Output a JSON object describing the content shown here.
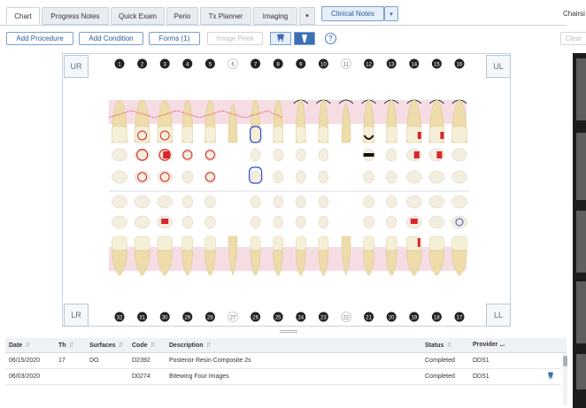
{
  "tabs": [
    {
      "label": "Chart",
      "active": true
    },
    {
      "label": "Progress Notes"
    },
    {
      "label": "Quick Exam"
    },
    {
      "label": "Perio"
    },
    {
      "label": "Tx Planner"
    },
    {
      "label": "Imaging"
    }
  ],
  "clinical_notes_label": "Clinical Notes",
  "chairside_label": "Chairsi",
  "toolbar": {
    "add_procedure": "Add Procedure",
    "add_condition": "Add Condition",
    "forms": "Forms (1)",
    "image_peek": "Image Peek",
    "help": "?",
    "clear": "Clear"
  },
  "quadrants": {
    "ur": "UR",
    "ul": "UL",
    "lr": "LR",
    "ll": "LL"
  },
  "upper_tooth_numbers": [
    "1",
    "2",
    "3",
    "4",
    "5",
    "6",
    "7",
    "8",
    "9",
    "10",
    "11",
    "12",
    "13",
    "14",
    "15",
    "16"
  ],
  "lower_tooth_numbers": [
    "32",
    "31",
    "30",
    "29",
    "28",
    "27",
    "26",
    "25",
    "24",
    "23",
    "22",
    "21",
    "20",
    "19",
    "18",
    "17"
  ],
  "colors": {
    "accent": "#2a5d9f",
    "restoration": "#d7262b",
    "watch": "#2b4fd6",
    "gum": "#f6dde3"
  },
  "grid": {
    "columns": [
      "Date",
      "Th",
      "Surfaces",
      "Code",
      "Description",
      "Status",
      "Provider ..."
    ],
    "rows": [
      {
        "date": "06/15/2020",
        "th": "17",
        "surfaces": "DO",
        "code": "D2392",
        "description": "Posterior Resin Composite 2s",
        "status": "Completed",
        "provider": "DDS1"
      },
      {
        "date": "06/03/2020",
        "th": "",
        "surfaces": "",
        "code": "D0274",
        "description": "Bitewing Four Images",
        "status": "Completed",
        "provider": "DDS1"
      }
    ]
  }
}
